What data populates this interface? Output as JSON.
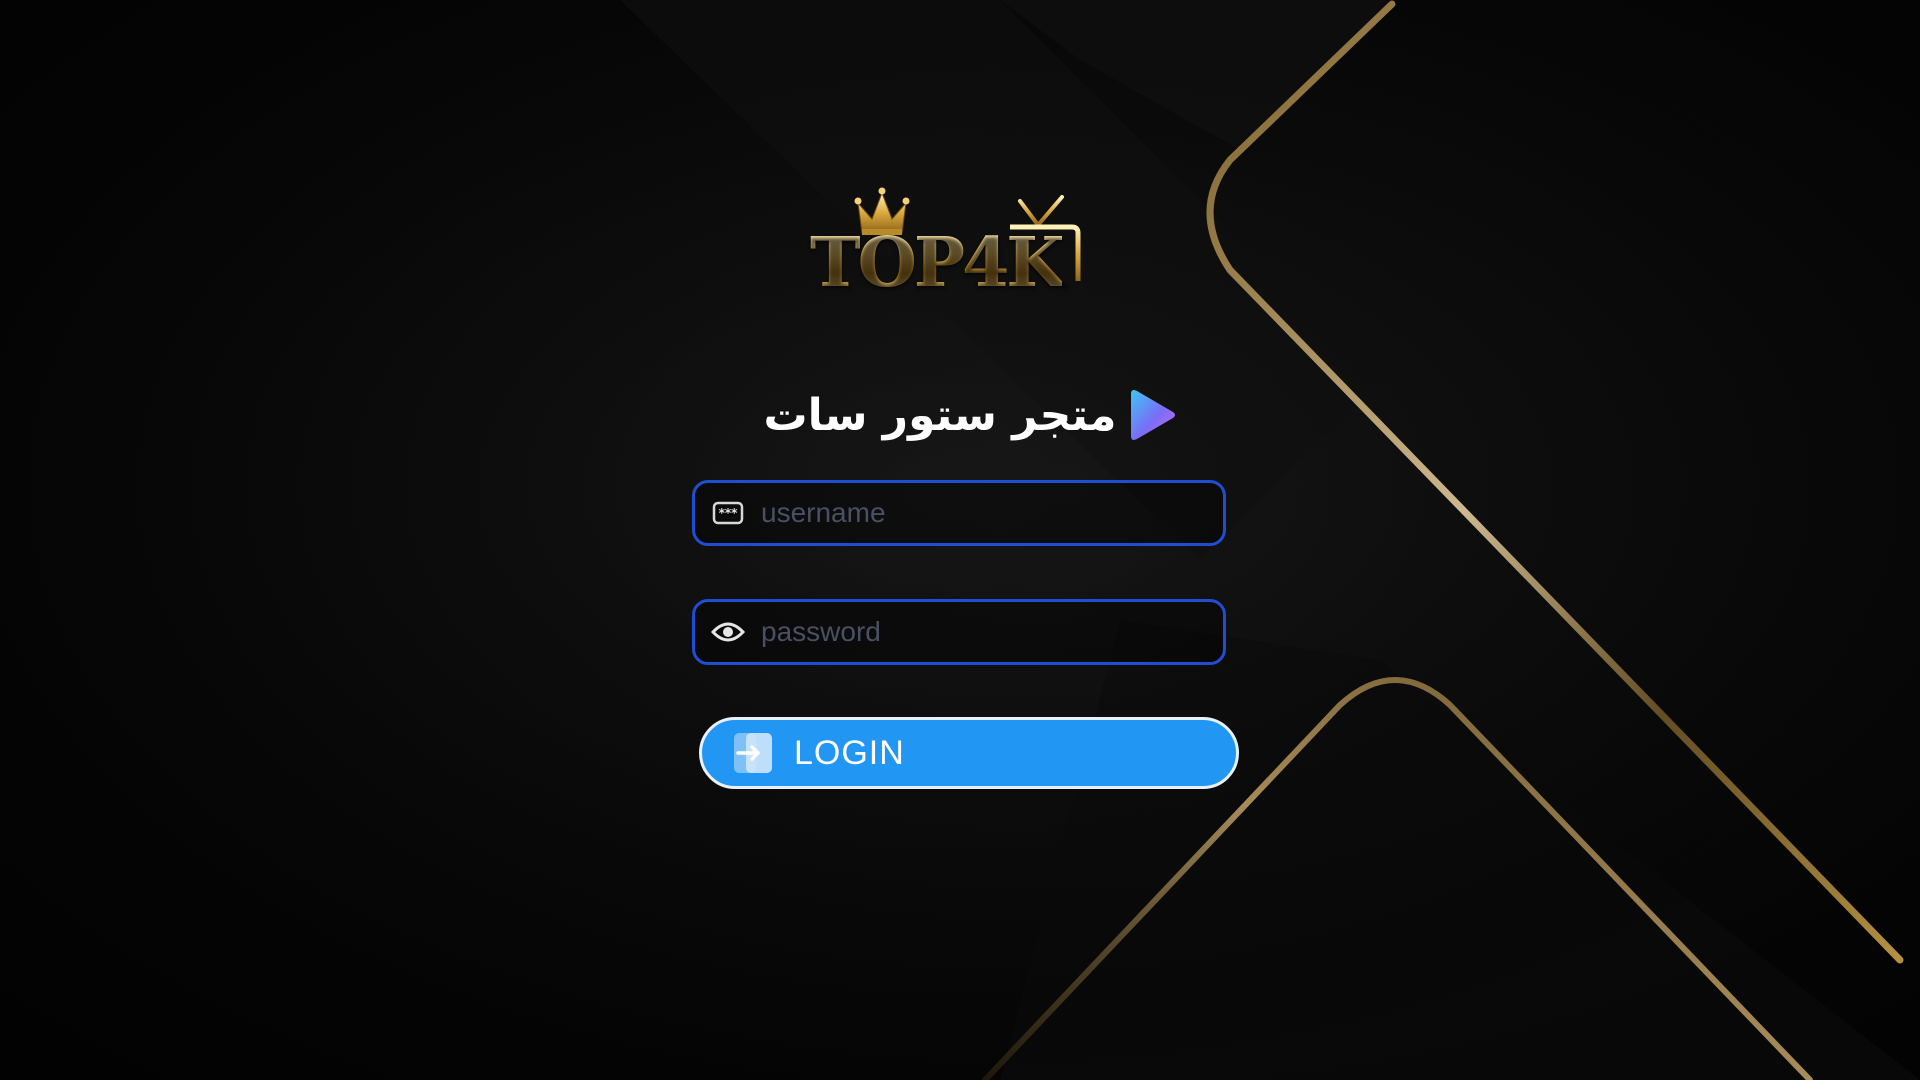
{
  "brand": {
    "logo_text": "TOP4K"
  },
  "store": {
    "title": "متجر ستور سات",
    "play_icon": "play-triangle-icon"
  },
  "form": {
    "username": {
      "placeholder": "username",
      "value": "",
      "icon": "password-dots-icon"
    },
    "password": {
      "placeholder": "password",
      "value": "",
      "icon": "eye-icon"
    },
    "login": {
      "label": "LOGIN",
      "icon": "login-arrow-icon"
    }
  },
  "colors": {
    "background": "#050505",
    "gold": "#c9a04a",
    "field_border": "#1f4ed3",
    "button": "#2196f3",
    "placeholder": "#4a4f63"
  }
}
